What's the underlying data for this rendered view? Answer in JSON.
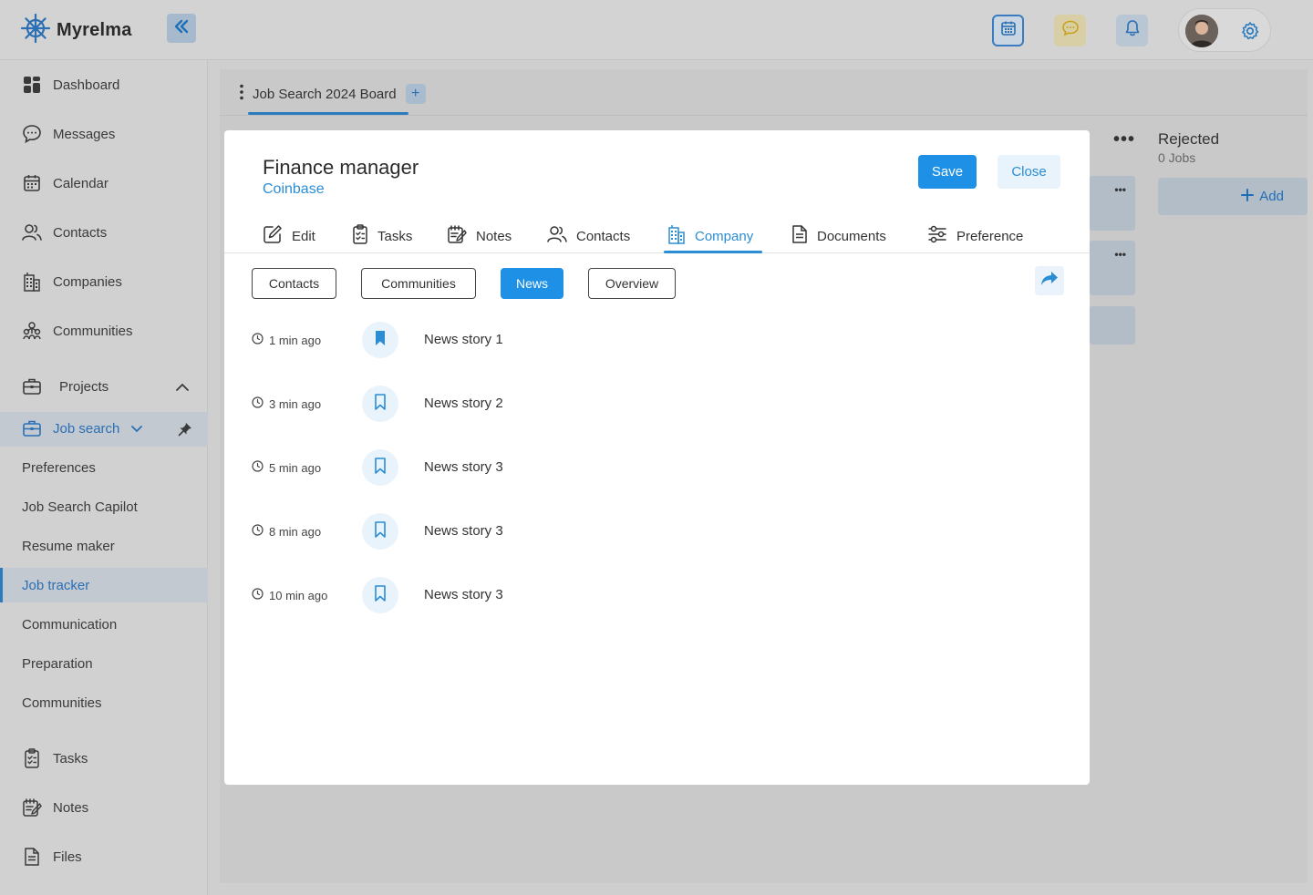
{
  "app": {
    "name": "Myrelma"
  },
  "sidebar": {
    "items": [
      {
        "label": "Dashboard",
        "icon": "dashboard-icon"
      },
      {
        "label": "Messages",
        "icon": "message-icon"
      },
      {
        "label": "Calendar",
        "icon": "calendar-icon"
      },
      {
        "label": "Contacts",
        "icon": "contacts-icon"
      },
      {
        "label": "Companies",
        "icon": "building-icon"
      },
      {
        "label": "Communities",
        "icon": "community-icon"
      }
    ],
    "projects_label": "Projects",
    "job_search_label": "Job search",
    "sub_items": [
      "Preferences",
      "Job Search Capilot",
      "Resume maker",
      "Job tracker",
      "Communication",
      "Preparation",
      "Communities"
    ],
    "bottom_items": [
      {
        "label": "Tasks",
        "icon": "tasks-icon"
      },
      {
        "label": "Notes",
        "icon": "notes-icon"
      },
      {
        "label": "Files",
        "icon": "file-icon"
      }
    ]
  },
  "board": {
    "tab_label": "Job Search 2024 Board",
    "add_tab": "+",
    "rejected": {
      "title": "Rejected",
      "count": "0 Jobs",
      "add_label": "Add"
    }
  },
  "modal": {
    "title": "Finance manager",
    "company": "Coinbase",
    "save_label": "Save",
    "close_label": "Close",
    "tabs": [
      "Edit",
      "Tasks",
      "Notes",
      "Contacts",
      "Company",
      "Documents",
      "Preference"
    ],
    "active_tab": "Company",
    "chips": [
      "Contacts",
      "Communities",
      "News",
      "Overview"
    ],
    "active_chip": "News",
    "news": [
      {
        "time": "1 min ago",
        "title": "News story 1",
        "bookmarked": true
      },
      {
        "time": "3 min ago",
        "title": "News story 2",
        "bookmarked": false
      },
      {
        "time": "5 min ago",
        "title": "News story 3",
        "bookmarked": false
      },
      {
        "time": "8 min ago",
        "title": "News story 3",
        "bookmarked": false
      },
      {
        "time": "10 min ago",
        "title": "News story 3",
        "bookmarked": false
      }
    ]
  },
  "colors": {
    "accent": "#1e90e6",
    "accent_text": "#2b8dd4",
    "sidebar_active": "#2b7bbf"
  }
}
